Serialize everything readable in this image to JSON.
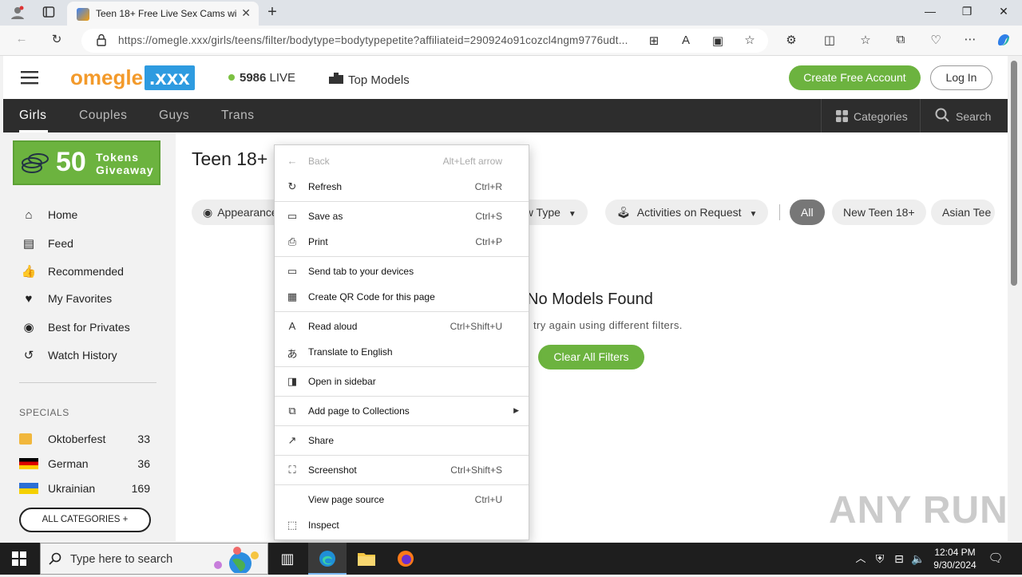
{
  "browser": {
    "tab_title": "Teen 18+ Free Live Sex Cams with",
    "url": "https://omegle.xxx/girls/teens/filter/bodytype=bodytypepetite?affiliateid=290924o91cozcl4ngm9776udt..."
  },
  "header": {
    "logo_a": "omegle",
    "logo_b": ".xxx",
    "live_count": "5986",
    "live_label": "LIVE",
    "top_models": "Top Models",
    "create_account": "Create Free Account",
    "login": "Log In"
  },
  "nav": {
    "tabs": [
      "Girls",
      "Couples",
      "Guys",
      "Trans"
    ],
    "categories": "Categories",
    "search": "Search"
  },
  "sidebar": {
    "tokens_num": "50",
    "tokens_line1": "Tokens",
    "tokens_line2": "Giveaway",
    "items": [
      "Home",
      "Feed",
      "Recommended",
      "My Favorites",
      "Best for Privates",
      "Watch History"
    ],
    "specials_label": "SPECIALS",
    "specials": [
      {
        "name": "Oktoberfest",
        "count": "33"
      },
      {
        "name": "German",
        "count": "36"
      },
      {
        "name": "Ukrainian",
        "count": "169"
      }
    ],
    "all_categories": "ALL CATEGORIES +"
  },
  "main": {
    "title": "Teen 18+",
    "chips": {
      "appearance": "Appearance",
      "show_type": "ow Type",
      "activities": "Activities on Request",
      "all": "All",
      "new_teen": "New Teen 18+",
      "asian": "Asian Tee"
    },
    "no_models": "No Models Found",
    "try_again": "try again using different filters.",
    "clear_filters": "Clear All Filters"
  },
  "context_menu": [
    {
      "label": "Back",
      "shortcut": "Alt+Left arrow"
    },
    {
      "label": "Refresh",
      "shortcut": "Ctrl+R"
    },
    {
      "label": "Save as",
      "shortcut": "Ctrl+S"
    },
    {
      "label": "Print",
      "shortcut": "Ctrl+P"
    },
    {
      "label": "Send tab to your devices",
      "shortcut": ""
    },
    {
      "label": "Create QR Code for this page",
      "shortcut": ""
    },
    {
      "label": "Read aloud",
      "shortcut": "Ctrl+Shift+U"
    },
    {
      "label": "Translate to English",
      "shortcut": ""
    },
    {
      "label": "Open in sidebar",
      "shortcut": ""
    },
    {
      "label": "Add page to Collections",
      "shortcut": ""
    },
    {
      "label": "Share",
      "shortcut": ""
    },
    {
      "label": "Screenshot",
      "shortcut": "Ctrl+Shift+S"
    },
    {
      "label": "View page source",
      "shortcut": "Ctrl+U"
    },
    {
      "label": "Inspect",
      "shortcut": ""
    }
  ],
  "watermark": "ANY RUN",
  "taskbar": {
    "search_placeholder": "Type here to search",
    "time": "12:04 PM",
    "date": "9/30/2024"
  },
  "colors": {
    "accent_green": "#6cb33f",
    "logo_orange": "#f39a2b",
    "logo_blue": "#2e9be0",
    "nav_dark": "#2d2d2d"
  }
}
